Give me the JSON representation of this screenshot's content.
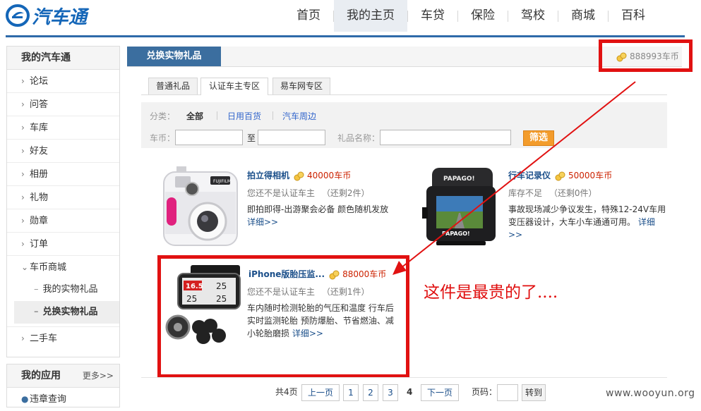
{
  "logo": {
    "text": "汽车通"
  },
  "nav": [
    "首页",
    "我的主页",
    "车贷",
    "保险",
    "驾校",
    "商城",
    "百科"
  ],
  "sidebar": {
    "title": "我的汽车通",
    "items": [
      "论坛",
      "问答",
      "车库",
      "好友",
      "相册",
      "礼物",
      "勋章",
      "订单"
    ],
    "group": "车币商城",
    "subitems": [
      "我的实物礼品",
      "兑换实物礼品"
    ],
    "after": "二手车",
    "apps_title": "我的应用",
    "apps_more": "更多>>",
    "apps_first": "违章查询"
  },
  "content": {
    "title": "兑换实物礼品",
    "coins": "888993车币",
    "tabs": [
      "普通礼品",
      "认证车主专区",
      "易车网专区"
    ]
  },
  "filter": {
    "category_label": "分类：",
    "categories": [
      "全部",
      "日用百货",
      "汽车周边"
    ],
    "coin_label": "车币：",
    "to_label": "至",
    "gift_name_label": "礼品名称：",
    "button": "筛选"
  },
  "products": [
    {
      "name": "拍立得相机",
      "price": "40000车币",
      "status": "您还不是认证车主",
      "remain": "（还剩2件）",
      "desc": "即拍即得-出游聚会必备 颜色随机发放",
      "more": "详细>>"
    },
    {
      "name": "行车记录仪",
      "price": "50000车币",
      "status": "库存不足",
      "remain": "（还剩0件）",
      "desc": "事故现场减少争议发生，特殊12-24V车用变压器设计，大车小车通通可用。",
      "more": "详细>>"
    },
    {
      "name": "iPhone版胎压监...",
      "price": "88000车币",
      "status": "您还不是认证车主",
      "remain": "（还剩1件）",
      "desc": "车内随时检测轮胎的气压和温度 行车后实时监测轮胎 预防爆胎、节省燃油、减小轮胎磨损",
      "more": "详细>>"
    }
  ],
  "pager": {
    "total": "共4页",
    "prev": "上一页",
    "pages": [
      "1",
      "2",
      "3",
      "4"
    ],
    "next": "下一页",
    "page_label": "页码：",
    "go": "转到"
  },
  "annotation": "这件是最贵的了....",
  "watermark": "www.wooyun.org",
  "colors": {
    "brand": "#1466b8",
    "nav_line": "#2e6aa9",
    "annotation_red": "#e11111",
    "filter_button": "#f39c2c"
  }
}
